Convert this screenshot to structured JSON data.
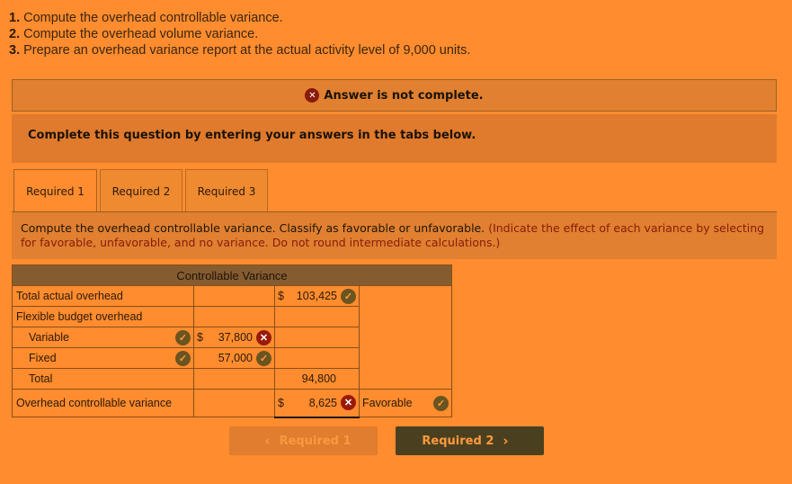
{
  "instructions": [
    {
      "num": "1.",
      "text": " Compute the overhead controllable variance."
    },
    {
      "num": "2.",
      "text": " Compute the overhead volume variance."
    },
    {
      "num": "3.",
      "text": " Prepare an overhead variance report at the actual activity level of 9,000 units."
    }
  ],
  "banner": {
    "icon": "x-circle-icon",
    "icon_glyph": "✕",
    "text": "Answer is not complete."
  },
  "complete_prompt": "Complete this question by entering your answers in the tabs below.",
  "tabs": [
    {
      "label": "Required 1",
      "active": true
    },
    {
      "label": "Required 2",
      "active": false
    },
    {
      "label": "Required 3",
      "active": false
    }
  ],
  "task": {
    "text": "Compute the overhead controllable variance. Classify as favorable or unfavorable. ",
    "hint": "(Indicate the effect of each variance by selecting for favorable, unfavorable, and no variance. Do not round intermediate calculations.)"
  },
  "table": {
    "title": "Controllable Variance",
    "rows": {
      "total_actual": {
        "label": "Total actual overhead",
        "dollar": "$",
        "value": "103,425",
        "status": "correct"
      },
      "flexible_budget": {
        "label": "Flexible budget overhead"
      },
      "variable": {
        "label": "Variable",
        "label_status": "correct",
        "dollar": "$",
        "value": "37,800",
        "status": "incorrect"
      },
      "fixed": {
        "label": "Fixed",
        "label_status": "correct",
        "value": "57,000",
        "status": "correct"
      },
      "total": {
        "label": "Total",
        "value": "94,800"
      },
      "controllable": {
        "label": "Overhead controllable variance",
        "dollar": "$",
        "value": "8,625",
        "status": "incorrect",
        "classification": "Favorable",
        "classification_status": "correct"
      }
    }
  },
  "nav": {
    "prev_label": "Required 1",
    "next_label": "Required 2",
    "prev_icon": "‹",
    "next_icon": "›"
  },
  "colors": {
    "background": "#ff8c2e",
    "correct": "#6a5420",
    "incorrect": "#9a1a0a",
    "table_header": "#855c30",
    "next_button": "#4a4020"
  }
}
